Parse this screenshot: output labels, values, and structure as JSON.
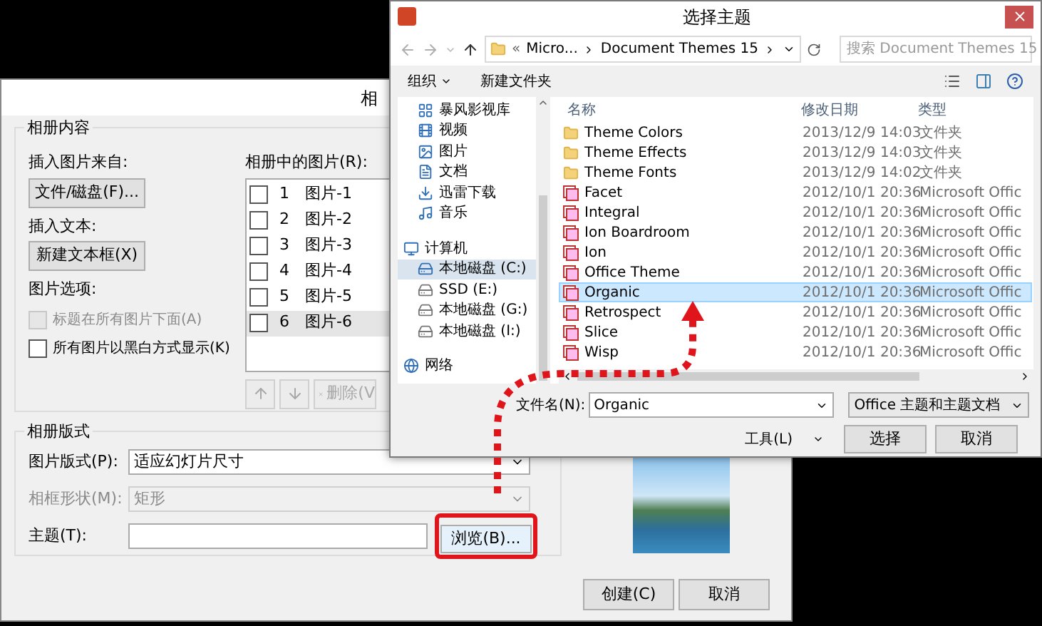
{
  "album_dialog": {
    "title": "相",
    "content_group": {
      "legend": "相册内容",
      "insert_from_label": "插入图片来自:",
      "file_button": "文件/磁盘(F)...",
      "insert_text_label": "插入文本:",
      "textbox_button": "新建文本框(X)",
      "options_label": "图片选项:",
      "options": [
        {
          "label": "标题在所有图片下面(A)",
          "checked": false,
          "disabled": true
        },
        {
          "label": "所有图片以黑白方式显示(K)",
          "checked": false,
          "disabled": false
        }
      ],
      "pictures_label": "相册中的图片(R):",
      "pictures": [
        {
          "number": "1",
          "name": "图片-1",
          "checked": false,
          "selected": false
        },
        {
          "number": "2",
          "name": "图片-2",
          "checked": false,
          "selected": false
        },
        {
          "number": "3",
          "name": "图片-3",
          "checked": false,
          "selected": false
        },
        {
          "number": "4",
          "name": "图片-4",
          "checked": false,
          "selected": false
        },
        {
          "number": "5",
          "name": "图片-5",
          "checked": false,
          "selected": false
        },
        {
          "number": "6",
          "name": "图片-6",
          "checked": false,
          "selected": true
        }
      ],
      "list_buttons": [
        {
          "kind": "up",
          "disabled": true
        },
        {
          "kind": "down",
          "disabled": true
        },
        {
          "kind": "delete",
          "label": "删除(V",
          "disabled": true
        }
      ]
    },
    "layout_group": {
      "legend": "相册版式",
      "fields": [
        {
          "label": "图片版式(P):",
          "value": "适应幻灯片尺寸",
          "kind": "select",
          "disabled": false
        },
        {
          "label": "相框形状(M):",
          "value": "矩形",
          "kind": "select",
          "disabled": true
        },
        {
          "label": "主题(T):",
          "kind": "text",
          "disabled": false
        }
      ],
      "browse_button": "浏览(B)..."
    },
    "buttons": [
      "创建(C)",
      "取消"
    ]
  },
  "theme_dialog": {
    "title": "选择主题",
    "breadcrumb_overflow": "«",
    "breadcrumb": [
      "Micro...",
      "Document Themes 15"
    ],
    "search": {
      "placeholder": "搜索 Document Themes 15"
    },
    "toolbar": [
      "组织",
      "新建文件夹"
    ],
    "nav": [
      {
        "items": [
          {
            "label": "暴风影视库",
            "kind": "library",
            "selected": false
          },
          {
            "label": "视频",
            "kind": "video",
            "selected": false
          },
          {
            "label": "图片",
            "kind": "picture",
            "selected": false
          },
          {
            "label": "文档",
            "kind": "document",
            "selected": false
          },
          {
            "label": "迅雷下载",
            "kind": "download",
            "selected": false
          },
          {
            "label": "音乐",
            "kind": "music",
            "selected": false
          }
        ]
      },
      {
        "label": "计算机",
        "kind": "computer",
        "children": [
          {
            "label": "本地磁盘 (C:)",
            "kind": "system-drive",
            "selected": true
          },
          {
            "label": "SSD (E:)",
            "kind": "drive",
            "selected": false
          },
          {
            "label": "本地磁盘 (G:)",
            "kind": "drive",
            "selected": false
          },
          {
            "label": "本地磁盘 (I:)",
            "kind": "drive",
            "selected": false
          }
        ]
      },
      {
        "label": "网络",
        "kind": "network"
      }
    ],
    "columns": [
      "名称",
      "修改日期",
      "类型"
    ],
    "files": [
      {
        "name": "Theme Colors",
        "date": "2013/12/9 14:03",
        "type": "文件夹",
        "kind": "folder",
        "selected": false
      },
      {
        "name": "Theme Effects",
        "date": "2013/12/9 14:03",
        "type": "文件夹",
        "kind": "folder",
        "selected": false
      },
      {
        "name": "Theme Fonts",
        "date": "2013/12/9 14:02",
        "type": "文件夹",
        "kind": "folder",
        "selected": false
      },
      {
        "name": "Facet",
        "date": "2012/10/1 20:36",
        "type": "Microsoft Offic",
        "kind": "theme",
        "selected": false
      },
      {
        "name": "Integral",
        "date": "2012/10/1 20:36",
        "type": "Microsoft Offic",
        "kind": "theme",
        "selected": false
      },
      {
        "name": "Ion Boardroom",
        "date": "2012/10/1 20:36",
        "type": "Microsoft Offic",
        "kind": "theme",
        "selected": false
      },
      {
        "name": "Ion",
        "date": "2012/10/1 20:36",
        "type": "Microsoft Offic",
        "kind": "theme",
        "selected": false
      },
      {
        "name": "Office Theme",
        "date": "2012/10/1 20:36",
        "type": "Microsoft Offic",
        "kind": "theme",
        "selected": false
      },
      {
        "name": "Organic",
        "date": "2012/10/1 20:36",
        "type": "Microsoft Offic",
        "kind": "theme",
        "selected": true
      },
      {
        "name": "Retrospect",
        "date": "2012/10/1 20:36",
        "type": "Microsoft Offic",
        "kind": "theme",
        "selected": false
      },
      {
        "name": "Slice",
        "date": "2012/10/1 20:36",
        "type": "Microsoft Offic",
        "kind": "theme",
        "selected": false
      },
      {
        "name": "Wisp",
        "date": "2012/10/1 20:36",
        "type": "Microsoft Offic",
        "kind": "theme",
        "selected": false
      }
    ],
    "file_name": {
      "label": "文件名(N):",
      "value": "Organic"
    },
    "file_type": "Office 主题和主题文档",
    "tools": "工具(L)",
    "buttons": [
      "选择",
      "取消"
    ]
  }
}
